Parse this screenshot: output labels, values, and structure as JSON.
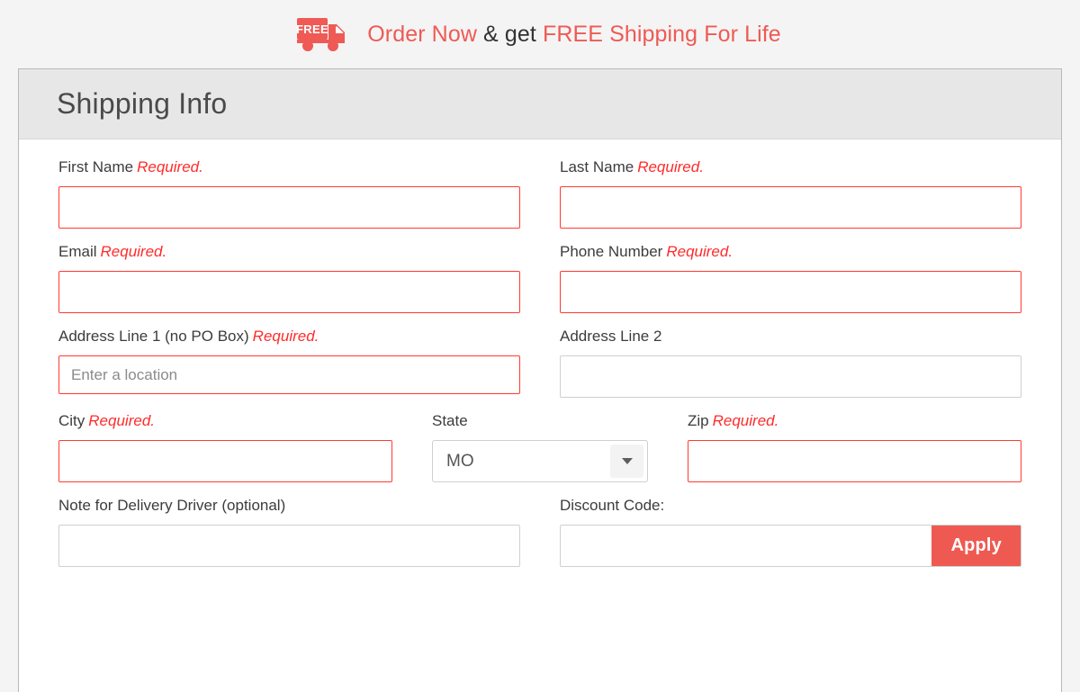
{
  "promo": {
    "icon": "free-shipping-truck-icon",
    "icon_label": "FREE",
    "prefix": "Order Now",
    "middle": " & get ",
    "suffix": "FREE Shipping For Life",
    "accent_color": "#ef5a55",
    "text_color": "#333333"
  },
  "panel": {
    "title": "Shipping Info",
    "header_bg": "#e7e7e7",
    "border_color": "#b9b9b9"
  },
  "required_marker": "Required.",
  "required_color": "#ff2b2b",
  "form": {
    "first_name": {
      "label": "First Name",
      "required": "Required.",
      "value": "",
      "placeholder": ""
    },
    "last_name": {
      "label": "Last Name",
      "required": "Required.",
      "value": "",
      "placeholder": ""
    },
    "email": {
      "label": "Email",
      "required": "Required.",
      "value": "",
      "placeholder": ""
    },
    "phone_number": {
      "label": "Phone Number",
      "required": "Required.",
      "value": "",
      "placeholder": ""
    },
    "address_line_1": {
      "label": "Address Line 1 (no PO Box)",
      "required": "Required.",
      "value": "",
      "placeholder": "Enter a location"
    },
    "address_line_2": {
      "label": "Address Line 2",
      "required": "",
      "value": "",
      "placeholder": ""
    },
    "city": {
      "label": "City",
      "required": "Required.",
      "value": "",
      "placeholder": ""
    },
    "state": {
      "label": "State",
      "required": "",
      "selected": "MO"
    },
    "zip": {
      "label": "Zip",
      "required": "Required.",
      "value": "",
      "placeholder": ""
    },
    "delivery_note": {
      "label": "Note for Delivery Driver (optional)",
      "required": "",
      "value": "",
      "placeholder": ""
    },
    "discount_code": {
      "label": "Discount Code:",
      "required": "",
      "value": "",
      "placeholder": "",
      "apply_label": "Apply",
      "apply_color": "#ee5a51"
    }
  }
}
